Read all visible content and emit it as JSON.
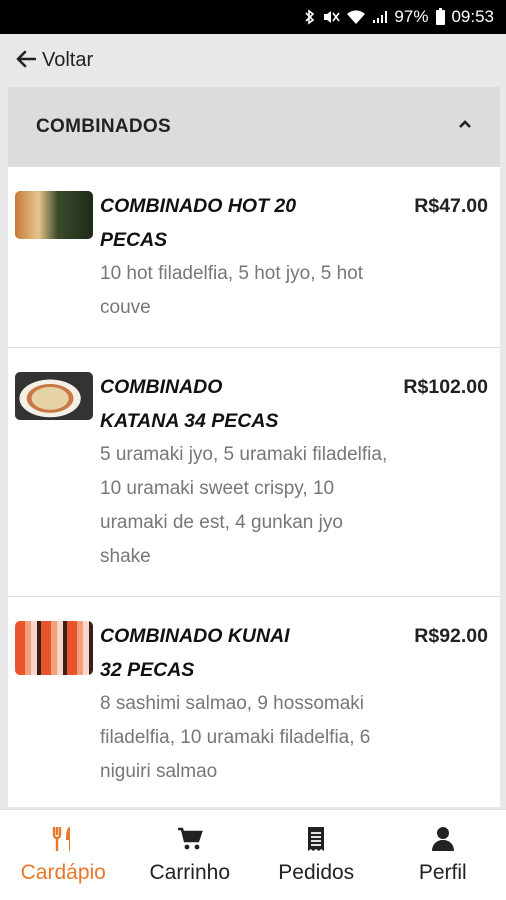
{
  "status_bar": {
    "battery": "97%",
    "time": "09:53"
  },
  "header": {
    "back_label": "Voltar"
  },
  "section": {
    "title": "COMBINADOS"
  },
  "items": [
    {
      "name_line1": "COMBINADO HOT 20",
      "name_line2": "PECAS",
      "price": "R$47.00",
      "desc": [
        "10 hot filadelfia, 5 hot jyo, 5 hot",
        "couve"
      ]
    },
    {
      "name_line1": "COMBINADO",
      "name_line2": "KATANA 34 PECAS",
      "price": "R$102.00",
      "desc": [
        "5 uramaki jyo, 5 uramaki filadelfia,",
        "10 uramaki sweet crispy, 10",
        "uramaki de est, 4 gunkan jyo",
        "shake"
      ]
    },
    {
      "name_line1": "COMBINADO KUNAI",
      "name_line2": "32 PECAS",
      "price": "R$92.00",
      "desc": [
        "8 sashimi salmao, 9 hossomaki",
        "filadelfia, 10 uramaki filadelfia, 6",
        "niguiri salmao"
      ]
    }
  ],
  "bottom_nav": [
    {
      "label": "Cardápio",
      "icon": "fork-knife-icon",
      "active": true
    },
    {
      "label": "Carrinho",
      "icon": "cart-icon",
      "active": false
    },
    {
      "label": "Pedidos",
      "icon": "receipt-icon",
      "active": false
    },
    {
      "label": "Perfil",
      "icon": "person-icon",
      "active": false
    }
  ],
  "colors": {
    "accent": "#e8772a",
    "header_bg": "#dcdcdc",
    "price_text": "#222222"
  }
}
